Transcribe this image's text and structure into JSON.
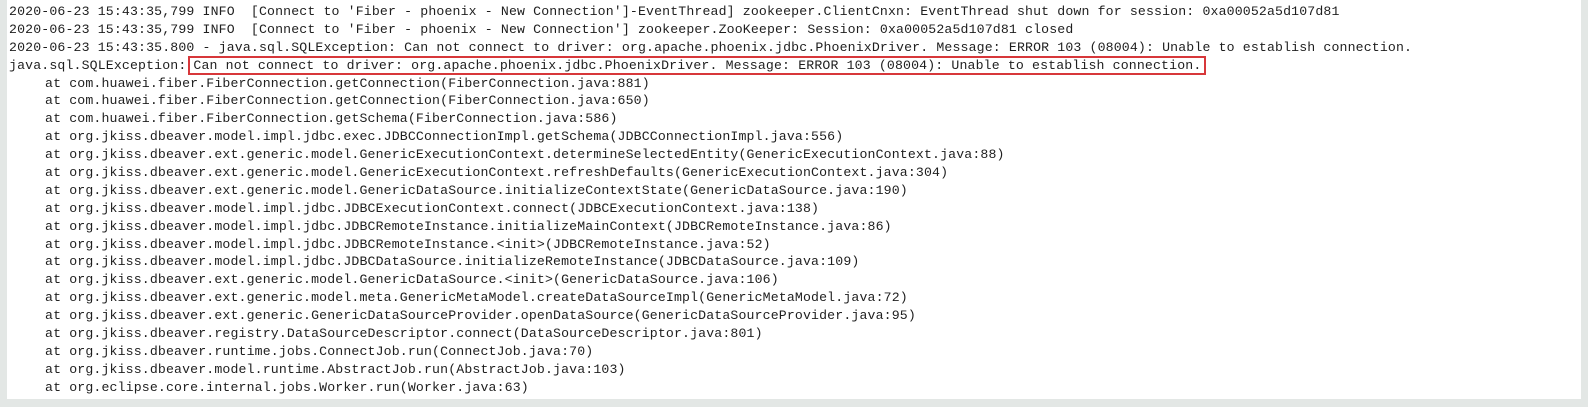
{
  "colors": {
    "background": "#e3e7e5",
    "panel": "#ffffff",
    "text": "#1e1e1e",
    "highlight_border": "#d7373a"
  },
  "log": {
    "header_lines": [
      "2020-06-23 15:43:35,799 INFO  [Connect to 'Fiber - phoenix - New Connection']-EventThread] zookeeper.ClientCnxn: EventThread shut down for session: 0xa00052a5d107d81",
      "2020-06-23 15:43:35,799 INFO  [Connect to 'Fiber - phoenix - New Connection'] zookeeper.ZooKeeper: Session: 0xa00052a5d107d81 closed",
      "2020-06-23 15:43:35.800 - java.sql.SQLException: Can not connect to driver: org.apache.phoenix.jdbc.PhoenixDriver. Message: ERROR 103 (08004): Unable to establish connection."
    ],
    "exception_prefix": "java.sql.SQLException:",
    "exception_message": "Can not connect to driver: org.apache.phoenix.jdbc.PhoenixDriver. Message: ERROR 103 (08004): Unable to establish connection.",
    "stack_trace": [
      "at com.huawei.fiber.FiberConnection.getConnection(FiberConnection.java:881)",
      "at com.huawei.fiber.FiberConnection.getConnection(FiberConnection.java:650)",
      "at com.huawei.fiber.FiberConnection.getSchema(FiberConnection.java:586)",
      "at org.jkiss.dbeaver.model.impl.jdbc.exec.JDBCConnectionImpl.getSchema(JDBCConnectionImpl.java:556)",
      "at org.jkiss.dbeaver.ext.generic.model.GenericExecutionContext.determineSelectedEntity(GenericExecutionContext.java:88)",
      "at org.jkiss.dbeaver.ext.generic.model.GenericExecutionContext.refreshDefaults(GenericExecutionContext.java:304)",
      "at org.jkiss.dbeaver.ext.generic.model.GenericDataSource.initializeContextState(GenericDataSource.java:190)",
      "at org.jkiss.dbeaver.model.impl.jdbc.JDBCExecutionContext.connect(JDBCExecutionContext.java:138)",
      "at org.jkiss.dbeaver.model.impl.jdbc.JDBCRemoteInstance.initializeMainContext(JDBCRemoteInstance.java:86)",
      "at org.jkiss.dbeaver.model.impl.jdbc.JDBCRemoteInstance.<init>(JDBCRemoteInstance.java:52)",
      "at org.jkiss.dbeaver.model.impl.jdbc.JDBCDataSource.initializeRemoteInstance(JDBCDataSource.java:109)",
      "at org.jkiss.dbeaver.ext.generic.model.GenericDataSource.<init>(GenericDataSource.java:106)",
      "at org.jkiss.dbeaver.ext.generic.model.meta.GenericMetaModel.createDataSourceImpl(GenericMetaModel.java:72)",
      "at org.jkiss.dbeaver.ext.generic.GenericDataSourceProvider.openDataSource(GenericDataSourceProvider.java:95)",
      "at org.jkiss.dbeaver.registry.DataSourceDescriptor.connect(DataSourceDescriptor.java:801)",
      "at org.jkiss.dbeaver.runtime.jobs.ConnectJob.run(ConnectJob.java:70)",
      "at org.jkiss.dbeaver.model.runtime.AbstractJob.run(AbstractJob.java:103)",
      "at org.eclipse.core.internal.jobs.Worker.run(Worker.java:63)"
    ]
  }
}
